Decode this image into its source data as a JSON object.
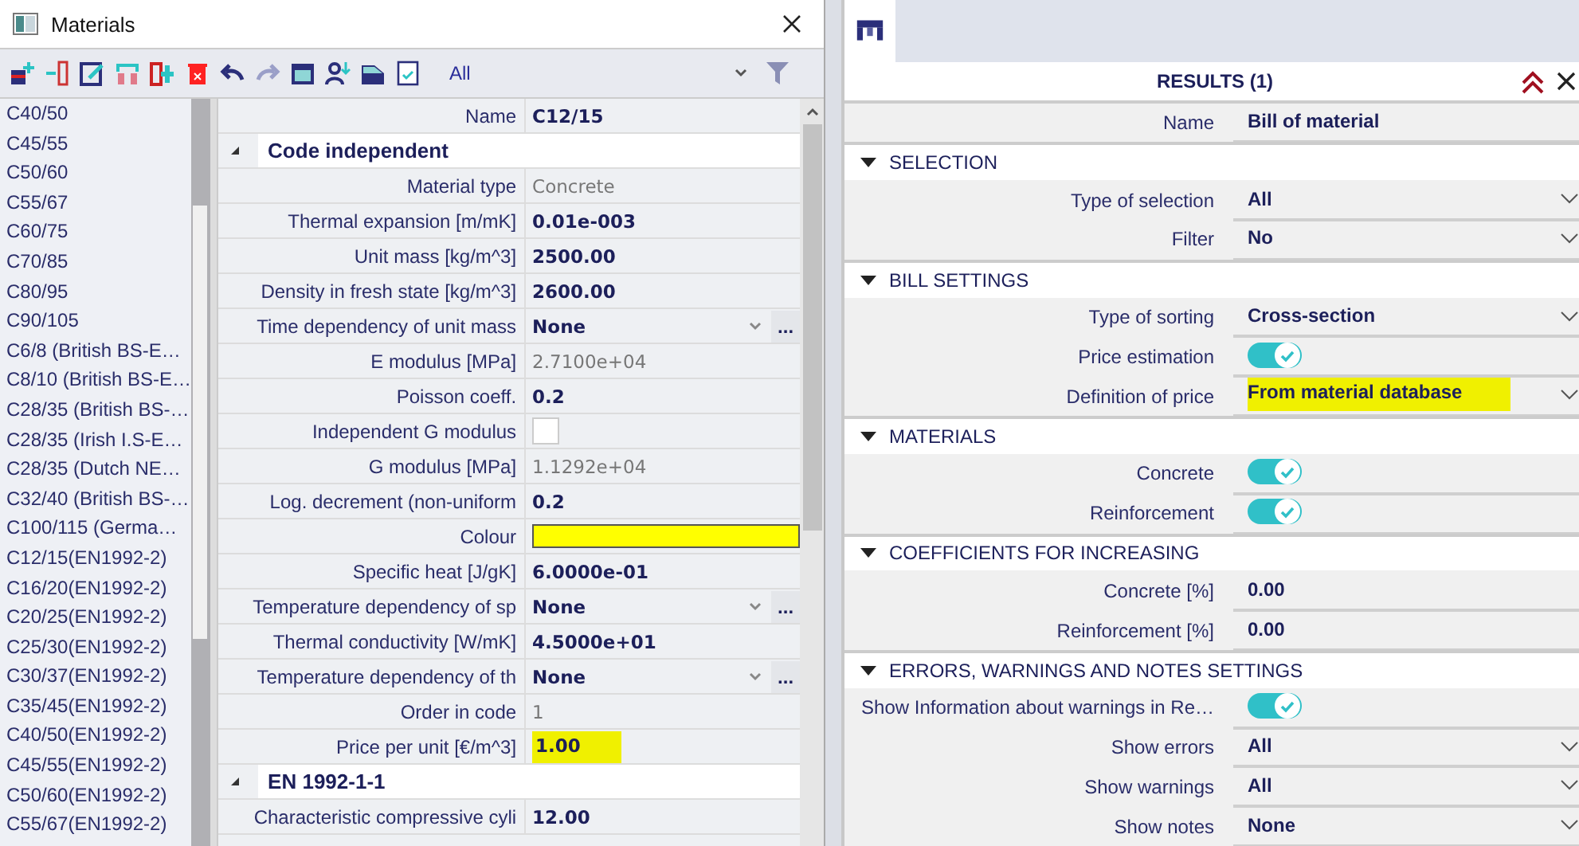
{
  "dialog": {
    "title": "Materials",
    "filter": "All",
    "materials": [
      "C40/50",
      "C45/55",
      "C50/60",
      "C55/67",
      "C60/75",
      "C70/85",
      "C80/95",
      "C90/105",
      "C6/8 (British BS-E…",
      "C8/10 (British BS-E…",
      "C28/35 (British BS-…",
      "C28/35 (Irish I.S-E…",
      "C28/35 (Dutch NE…",
      "C32/40 (British BS-…",
      "C100/115 (Germa…",
      "C12/15(EN1992-2)",
      "C16/20(EN1992-2)",
      "C20/25(EN1992-2)",
      "C25/30(EN1992-2)",
      "C30/37(EN1992-2)",
      "C35/45(EN1992-2)",
      "C40/50(EN1992-2)",
      "C45/55(EN1992-2)",
      "C50/60(EN1992-2)",
      "C55/67(EN1992-2)"
    ],
    "properties": [
      {
        "kind": "text",
        "label": "Name",
        "value": "C12/15",
        "readonly": false,
        "highlighted": false
      },
      {
        "kind": "section",
        "label": "Code independent",
        "expanded": true
      },
      {
        "kind": "text",
        "label": "Material type",
        "value": "Concrete",
        "readonly": true,
        "highlighted": false
      },
      {
        "kind": "text",
        "label": "Thermal expansion  [m/mK]",
        "value": "0.01e-003",
        "readonly": false,
        "highlighted": false
      },
      {
        "kind": "text",
        "label": "Unit mass [kg/m^3]",
        "value": "2500.00",
        "readonly": false,
        "highlighted": false
      },
      {
        "kind": "text",
        "label": "Density in fresh state [kg/m^3]",
        "value": "2600.00",
        "readonly": false,
        "highlighted": false
      },
      {
        "kind": "dropdown",
        "label": "Time dependency of unit mass",
        "value": "None",
        "more": "..."
      },
      {
        "kind": "text",
        "label": "E modulus [MPa]",
        "value": "2.7100e+04",
        "readonly": true,
        "highlighted": false
      },
      {
        "kind": "text",
        "label": "Poisson coeff.",
        "value": "0.2",
        "readonly": false,
        "highlighted": false
      },
      {
        "kind": "checkbox",
        "label": "Independent G modulus",
        "checked": false
      },
      {
        "kind": "text",
        "label": "G modulus [MPa]",
        "value": "1.1292e+04",
        "readonly": true,
        "highlighted": false
      },
      {
        "kind": "text",
        "label": "Log. decrement (non-uniform",
        "value": "0.2",
        "readonly": false,
        "highlighted": false
      },
      {
        "kind": "color",
        "label": "Colour",
        "color": "#ffff00"
      },
      {
        "kind": "text",
        "label": "Specific heat [J/gK]",
        "value": "6.0000e-01",
        "readonly": false,
        "highlighted": false
      },
      {
        "kind": "dropdown",
        "label": "Temperature dependency of sp",
        "value": "None",
        "more": "..."
      },
      {
        "kind": "text",
        "label": "Thermal conductivity [W/mK]",
        "value": "4.5000e+01",
        "readonly": false,
        "highlighted": false
      },
      {
        "kind": "dropdown",
        "label": "Temperature dependency of th",
        "value": "None",
        "more": "..."
      },
      {
        "kind": "text",
        "label": "Order in code",
        "value": "1",
        "readonly": true,
        "highlighted": false
      },
      {
        "kind": "text",
        "label": "Price per unit [€/m^3]",
        "value": "1.00",
        "readonly": false,
        "highlighted": true
      },
      {
        "kind": "section",
        "label": "EN 1992-1-1",
        "expanded": true
      },
      {
        "kind": "text",
        "label": "Characteristic compressive cyli",
        "value": "12.00",
        "readonly": false,
        "highlighted": false
      }
    ]
  },
  "results": {
    "title": "RESULTS (1)",
    "rows": [
      {
        "kind": "text",
        "label": "Name",
        "value": "Bill of material"
      },
      {
        "kind": "section",
        "label": "SELECTION",
        "expanded": true
      },
      {
        "kind": "dropdown",
        "label": "Type of selection",
        "value": "All",
        "highlighted": false
      },
      {
        "kind": "dropdown",
        "label": "Filter",
        "value": "No",
        "highlighted": false
      },
      {
        "kind": "section",
        "label": "BILL SETTINGS",
        "expanded": true
      },
      {
        "kind": "dropdown",
        "label": "Type of sorting",
        "value": "Cross-section",
        "highlighted": false
      },
      {
        "kind": "toggle",
        "label": "Price estimation",
        "on": true
      },
      {
        "kind": "dropdown",
        "label": "Definition of price",
        "value": "From material database",
        "highlighted": true
      },
      {
        "kind": "section",
        "label": "MATERIALS",
        "expanded": true
      },
      {
        "kind": "toggle",
        "label": "Concrete",
        "on": true
      },
      {
        "kind": "toggle",
        "label": "Reinforcement",
        "on": true
      },
      {
        "kind": "section",
        "label": "COEFFICIENTS FOR INCREASING",
        "expanded": true
      },
      {
        "kind": "text",
        "label": "Concrete [%]",
        "value": "0.00"
      },
      {
        "kind": "text",
        "label": "Reinforcement [%]",
        "value": "0.00"
      },
      {
        "kind": "section",
        "label": "ERRORS, WARNINGS AND NOTES SETTINGS",
        "expanded": true
      },
      {
        "kind": "toggle",
        "label": "Show Information about warnings in Re…",
        "on": true
      },
      {
        "kind": "dropdown",
        "label": "Show errors",
        "value": "All",
        "highlighted": false
      },
      {
        "kind": "dropdown",
        "label": "Show warnings",
        "value": "All",
        "highlighted": false
      },
      {
        "kind": "dropdown",
        "label": "Show notes",
        "value": "None",
        "highlighted": false
      }
    ]
  }
}
